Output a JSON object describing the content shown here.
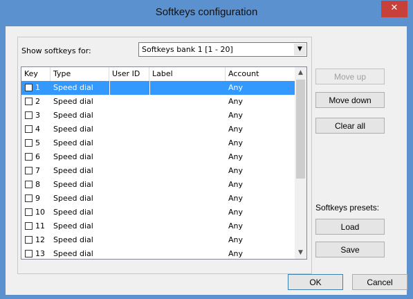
{
  "window": {
    "title": "Softkeys configuration"
  },
  "show_softkeys": {
    "label": "Show softkeys for:",
    "selected": "Softkeys bank 1 [1 - 20]"
  },
  "table": {
    "headers": {
      "key": "Key",
      "type": "Type",
      "user_id": "User ID",
      "label": "Label",
      "account": "Account"
    },
    "rows": [
      {
        "key": "1",
        "type": "Speed dial",
        "user_id": "",
        "label": "",
        "account": "Any"
      },
      {
        "key": "2",
        "type": "Speed dial",
        "user_id": "",
        "label": "",
        "account": "Any"
      },
      {
        "key": "3",
        "type": "Speed dial",
        "user_id": "",
        "label": "",
        "account": "Any"
      },
      {
        "key": "4",
        "type": "Speed dial",
        "user_id": "",
        "label": "",
        "account": "Any"
      },
      {
        "key": "5",
        "type": "Speed dial",
        "user_id": "",
        "label": "",
        "account": "Any"
      },
      {
        "key": "6",
        "type": "Speed dial",
        "user_id": "",
        "label": "",
        "account": "Any"
      },
      {
        "key": "7",
        "type": "Speed dial",
        "user_id": "",
        "label": "",
        "account": "Any"
      },
      {
        "key": "8",
        "type": "Speed dial",
        "user_id": "",
        "label": "",
        "account": "Any"
      },
      {
        "key": "9",
        "type": "Speed dial",
        "user_id": "",
        "label": "",
        "account": "Any"
      },
      {
        "key": "10",
        "type": "Speed dial",
        "user_id": "",
        "label": "",
        "account": "Any"
      },
      {
        "key": "11",
        "type": "Speed dial",
        "user_id": "",
        "label": "",
        "account": "Any"
      },
      {
        "key": "12",
        "type": "Speed dial",
        "user_id": "",
        "label": "",
        "account": "Any"
      },
      {
        "key": "13",
        "type": "Speed dial",
        "user_id": "",
        "label": "",
        "account": "Any"
      }
    ],
    "selected_row": 0
  },
  "buttons": {
    "move_up": "Move up",
    "move_down": "Move down",
    "clear_all": "Clear all",
    "presets_label": "Softkeys presets:",
    "load": "Load",
    "save": "Save",
    "ok": "OK",
    "cancel": "Cancel"
  },
  "colors": {
    "titlebar": "#5b91ce",
    "close": "#c7403a",
    "selection": "#3399ff"
  }
}
